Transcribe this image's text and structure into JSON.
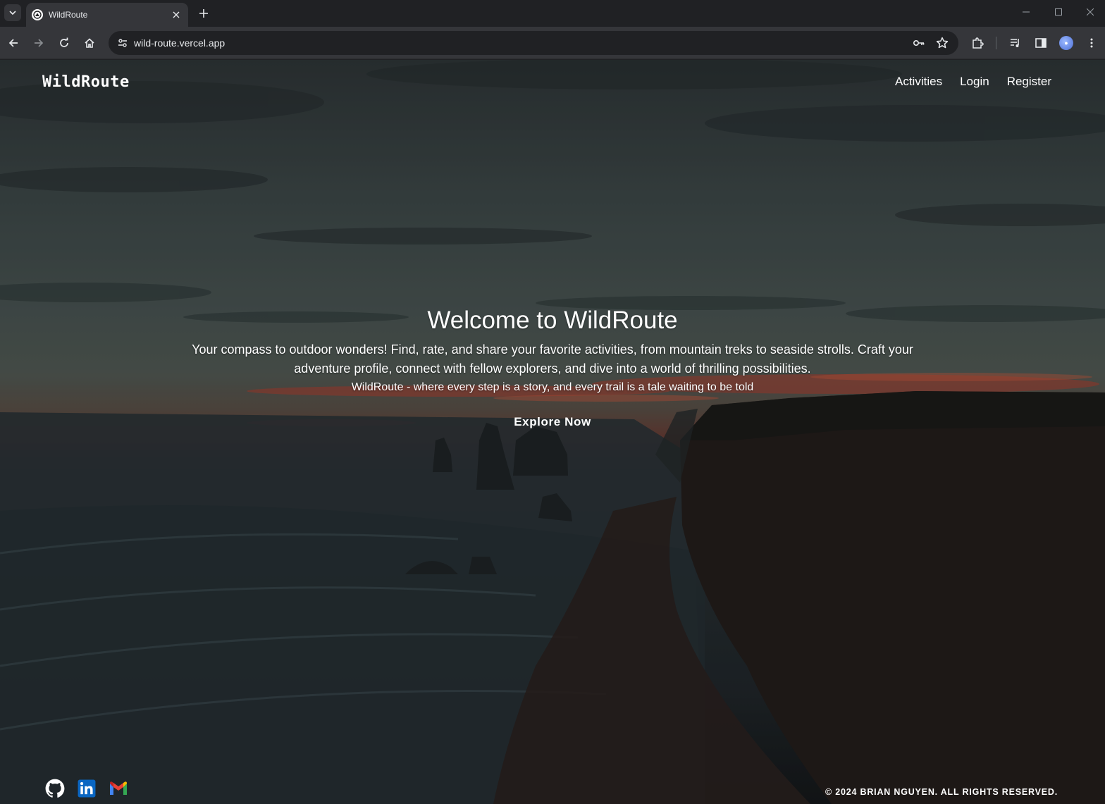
{
  "browser": {
    "tab_title": "WildRoute",
    "url": "wild-route.vercel.app",
    "icons": [
      "tab-search-icon",
      "back-arrow-icon",
      "forward-arrow-icon",
      "reload-icon",
      "home-icon",
      "site-settings-icon",
      "password-key-icon",
      "bookmark-star-icon",
      "extensions-puzzle-icon",
      "media-controls-icon",
      "side-panel-icon",
      "profile-avatar-icon",
      "more-vert-icon"
    ]
  },
  "nav": {
    "brand": "WildRoute",
    "links": [
      "Activities",
      "Login",
      "Register"
    ]
  },
  "hero": {
    "title": "Welcome to WildRoute",
    "description": "Your compass to outdoor wonders! Find, rate, and share your favorite activities, from mountain treks to seaside strolls. Craft your adventure profile, connect with fellow explorers, and dive into a world of thrilling possibilities.",
    "tagline": "WildRoute - where every step is a story, and every trail is a tale waiting to be told",
    "cta": "Explore Now"
  },
  "footer": {
    "social_icons": [
      "github-icon",
      "linkedin-icon",
      "gmail-icon"
    ],
    "copyright": "© 2024 BRIAN NGUYEN. ALL RIGHTS RESERVED."
  },
  "colors": {
    "chrome_dark": "#202124",
    "chrome_toolbar": "#35363a",
    "text_light": "#e8eaed",
    "sunset_red": "#b2402f",
    "linkedin_blue": "#0a66c2"
  }
}
